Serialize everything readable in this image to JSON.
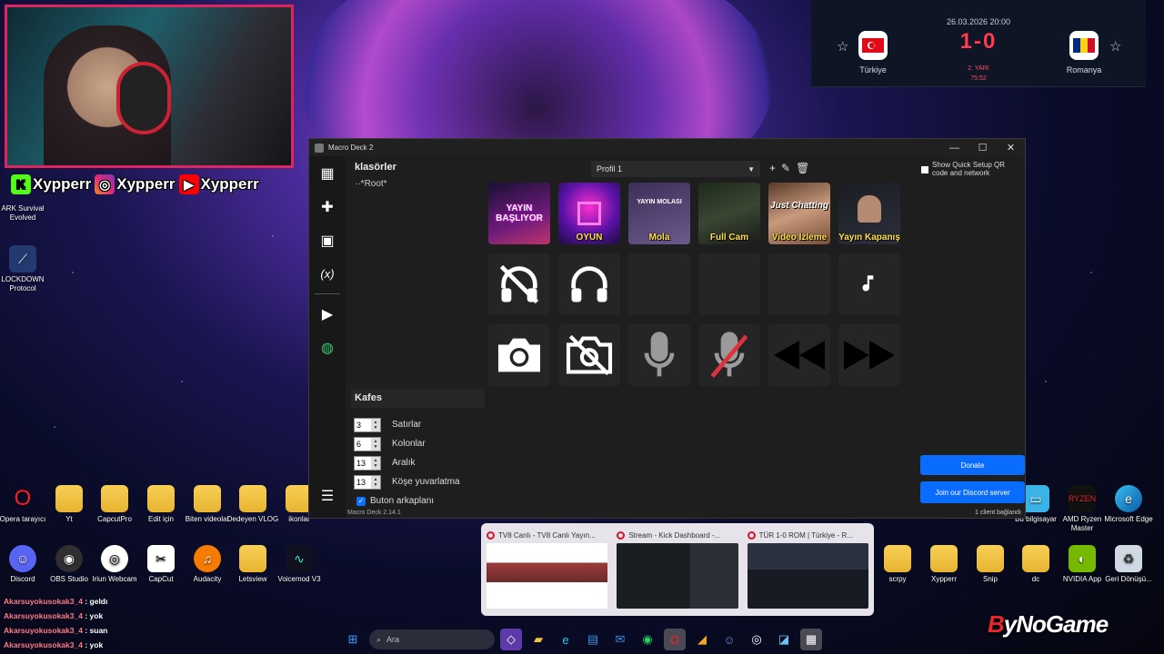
{
  "stream": {
    "socials": [
      {
        "icon": "kick-icon",
        "name": "Xypperr",
        "color": "#53fc18"
      },
      {
        "icon": "instagram-icon",
        "name": "Xypperr",
        "color": "#e1306c"
      },
      {
        "icon": "youtube-icon",
        "name": "Xypperr",
        "color": "#ff0000"
      }
    ],
    "scoreboard": {
      "date": "26.03.2026 20:00",
      "home": "Türkiye",
      "away": "Romanya",
      "score": "1-0",
      "period": "2. YARI",
      "minute": "75:52"
    },
    "brand": {
      "prefix": "B",
      "rest": "yNoGame"
    },
    "chat": [
      {
        "user": "Akarsuyokusokak3_4",
        "msg": ": geldı"
      },
      {
        "user": "Akarsuyokusokak3_4",
        "msg": ": yok"
      },
      {
        "user": "Akarsuyokusokak3_4",
        "msg": ": suan"
      },
      {
        "user": "Akarsuyokusokak3_4",
        "msg": ": yok"
      }
    ]
  },
  "desktop": {
    "left_icons": [
      "ARK Survival Evolved",
      "LOCKDOWN Protocol"
    ],
    "row1": [
      "Opera tarayıcı",
      "Yt",
      "CapcutPro",
      "Edit için",
      "Biten videolar",
      "Dedeyen VLOG",
      "ikonlar"
    ],
    "row2": [
      "Discord",
      "OBS Studio",
      "Iriun Webcam",
      "CapCut",
      "Audacity",
      "Letsview",
      "Voicemod V3"
    ],
    "right_row1": [
      "Bu bilgisayar",
      "AMD Ryzen Master",
      "Microsoft Edge"
    ],
    "right_row2": [
      "scrpy",
      "Xypperr",
      "Snip",
      "dc",
      "NVIDIA App",
      "Geri Dönüşü..."
    ]
  },
  "macro_deck": {
    "title": "Macro Deck 2",
    "folders_title": "klasörler",
    "root_folder": "*Root*",
    "profile": "Profil 1",
    "quick_setup": "Show Quick Setup QR code and network",
    "keys": [
      {
        "label": "",
        "banner": "YAYIN BAŞLIYOR"
      },
      {
        "label": "OYUN"
      },
      {
        "label": "Mola",
        "banner": "YAYIN MOLASI"
      },
      {
        "label": "Full Cam"
      },
      {
        "label": "Video İzleme",
        "banner": "Just Chatting"
      },
      {
        "label": "Yayın Kapanış"
      },
      {
        "icon": "headphones-off-icon"
      },
      {
        "icon": "headphones-icon"
      },
      {
        "icon": ""
      },
      {
        "icon": ""
      },
      {
        "icon": ""
      },
      {
        "icon": "music-note-icon"
      },
      {
        "icon": "camera-icon"
      },
      {
        "icon": "camera-off-icon"
      },
      {
        "icon": "microphone-icon"
      },
      {
        "icon": "microphone-off-icon"
      },
      {
        "icon": "rewind-icon"
      },
      {
        "icon": "fast-forward-icon"
      }
    ],
    "grid_title": "Kafes",
    "rows": {
      "value": "3",
      "label": "Satırlar"
    },
    "cols": {
      "value": "6",
      "label": "Kolonlar"
    },
    "spacing": {
      "value": "13",
      "label": "Aralık"
    },
    "radius": {
      "value": "13",
      "label": "Köşe yuvarlatma"
    },
    "bg_checkbox": {
      "checked": true,
      "label": "Buton arkaplanı"
    },
    "donate": "Donate",
    "discord": "Join our Discord server",
    "version": "Macro Deck 2.14.1",
    "clients": "1 client bağlandı"
  },
  "taskbar": {
    "search_placeholder": "Ara",
    "previews": [
      "TV8 Canlı - TV8 Canlı Yayın...",
      "Stream - Kick Dashboard -...",
      "TÜR 1-0 ROM | Türkiye - R..."
    ]
  }
}
